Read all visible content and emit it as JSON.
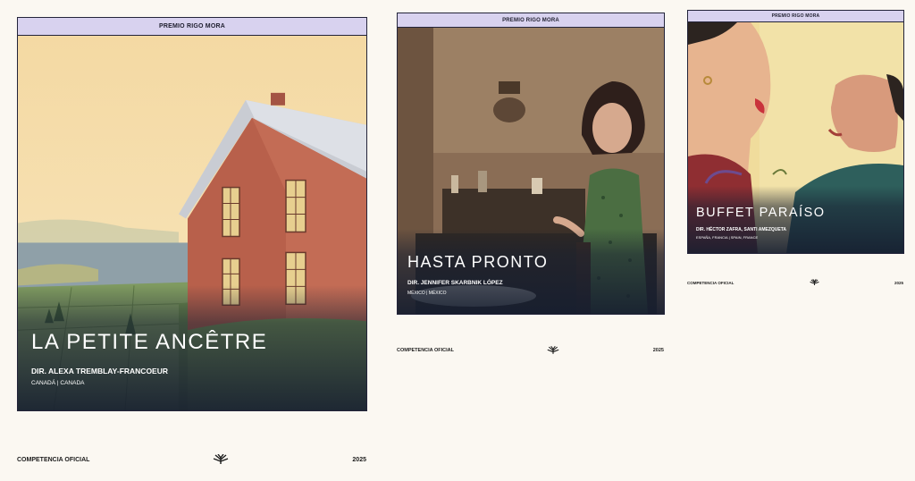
{
  "posters": [
    {
      "award": "PREMIO RIGO MORA",
      "title": "LA PETITE ANCÊTRE",
      "director": "DIR. ALEXA TREMBLAY-FRANCOEUR",
      "country": "CANADÁ | CANADA",
      "section": "COMPETENCIA OFICIAL",
      "year": "2025",
      "icon": "sprout-emblem-icon"
    },
    {
      "award": "PREMIO RIGO MORA",
      "title": "HASTA PRONTO",
      "director": "DIR. JENNIFER SKARBNIK LÓPEZ",
      "country": "MÉXICO | MÉXICO",
      "section": "COMPETENCIA OFICIAL",
      "year": "2025",
      "icon": "sprout-emblem-icon"
    },
    {
      "award": "PREMIO RIGO MORA",
      "title": "BUFFET PARAÍSO",
      "director": "DIR. HÉCTOR ZAFRA, SANTI AMEZQUETA",
      "country": "ESPAÑA, FRANCIA | SPAIN, FRANCE",
      "section": "COMPETENCIA OFICIAL",
      "year": "2025",
      "icon": "sprout-emblem-icon"
    }
  ],
  "colors": {
    "background": "#fbf8f2",
    "banner": "#d8d2ef",
    "border": "#23243a"
  }
}
